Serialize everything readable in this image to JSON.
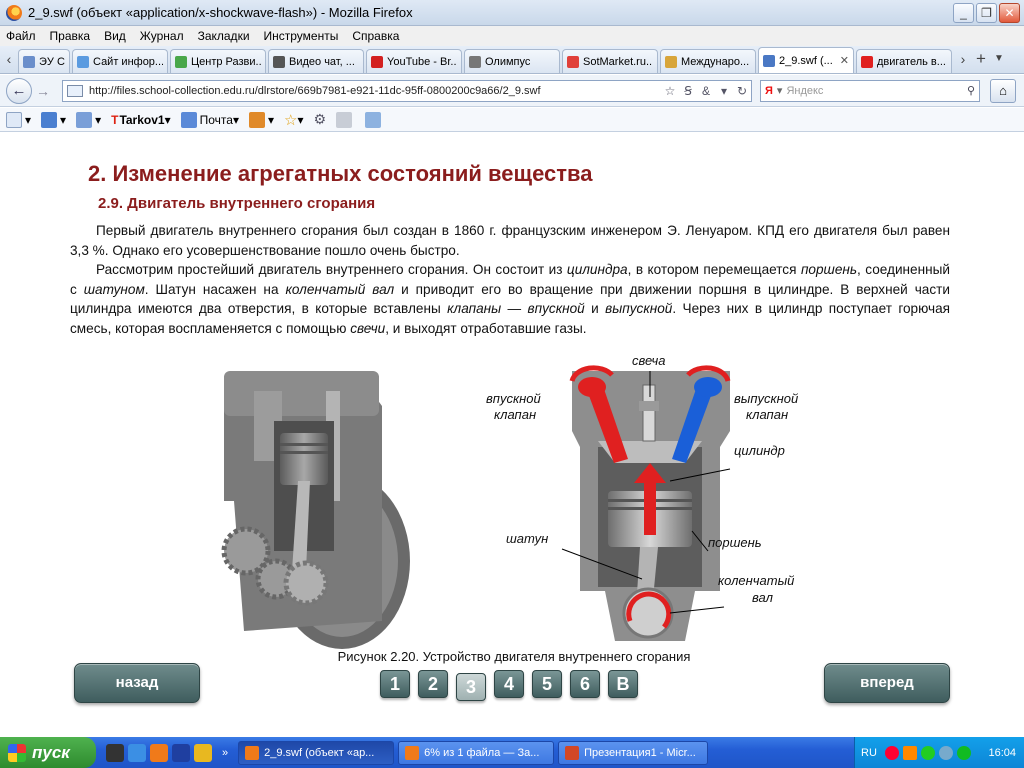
{
  "window": {
    "title": "2_9.swf (объект «application/x-shockwave-flash») - Mozilla Firefox"
  },
  "menu": [
    "Файл",
    "Правка",
    "Вид",
    "Журнал",
    "Закладки",
    "Инструменты",
    "Справка"
  ],
  "tabs": [
    {
      "label": "ЭУ С...",
      "color": "#6a8ecb"
    },
    {
      "label": "Сайт инфор...",
      "color": "#5b9be0"
    },
    {
      "label": "Центр Разви...",
      "color": "#49a74a"
    },
    {
      "label": "Видео чат, ...",
      "color": "#555555"
    },
    {
      "label": "YouTube - Br...",
      "color": "#d32020"
    },
    {
      "label": "Олимпус",
      "color": "#777777"
    },
    {
      "label": "SotMarket.ru...",
      "color": "#e0403a"
    },
    {
      "label": "Междунаро...",
      "color": "#d8a53a"
    },
    {
      "label": "2_9.swf (...",
      "color": "#4a78c4",
      "active": true
    },
    {
      "label": "двигатель в...",
      "color": "#e02020"
    }
  ],
  "nav": {
    "url": "http://files.school-collection.edu.ru/dlrstore/669b7981-e921-11dc-95ff-0800200c9a66/2_9.swf",
    "search_placeholder": "Яндекс",
    "search_engine": "Я"
  },
  "toolbar": {
    "user": "Tarkov1",
    "mail": "Почта"
  },
  "page": {
    "title": "2. Изменение агрегатных состояний вещества",
    "subtitle": "2.9. Двигатель внутреннего сгорания",
    "p1": "Первый двигатель внутреннего сгорания был создан в 1860 г. французским инженером Э. Ленуаром. КПД его двигателя был равен 3,3 %. Однако его усовершенствование пошло очень быстро.",
    "p2_a": "Рассмотрим простейший двигатель внутреннего сгорания. Он состоит из ",
    "p2_cyl": "цилиндра",
    "p2_b": ", в котором перемещается ",
    "p2_piston": "поршень",
    "p2_c": ", соединенный с ",
    "p2_rod": "шатуном",
    "p2_d": ". Шатун насажен на ",
    "p2_crank": "коленчатый вал",
    "p2_e": " и приводит его во вращение при движении поршня в цилиндре. В верхней части цилиндра имеются два отверстия, в которые вставлены ",
    "p2_valves": "клапаны",
    "p2_f": " — ",
    "p2_in": "впускной",
    "p2_g": " и ",
    "p2_out": "выпускной",
    "p2_h": ". Через них в цилиндр поступает горючая смесь, которая воспламеняется с помощью ",
    "p2_spark": "свечи",
    "p2_i": ", и выходят отработавшие газы.",
    "caption": "Рисунок 2.20. Устройство двигателя внутреннего сгорания"
  },
  "diagram_labels": {
    "spark": "свеча",
    "intake_1": "впускной",
    "intake_2": "клапан",
    "exhaust_1": "выпускной",
    "exhaust_2": "клапан",
    "cylinder": "цилиндр",
    "rod": "шатун",
    "piston": "поршень",
    "crank_1": "коленчатый",
    "crank_2": "вал"
  },
  "navigation": {
    "back": "назад",
    "forward": "вперед",
    "pages": [
      "1",
      "2",
      "3",
      "4",
      "5",
      "6",
      "В"
    ],
    "current_page": "3"
  },
  "taskbar": {
    "start": "пуск",
    "tasks": [
      {
        "label": "2_9.swf (объект «ар...",
        "color": "#f07a1a",
        "active": true
      },
      {
        "label": "6% из 1 файла — За...",
        "color": "#f07a1a"
      },
      {
        "label": "Презентация1 - Micr...",
        "color": "#d24726"
      }
    ],
    "lang": "RU",
    "time": "16:04"
  },
  "colors": {
    "heading": "#8b1d1d",
    "button": "#4f6c6c",
    "intake": "#e02020",
    "exhaust": "#1a5fd8"
  }
}
